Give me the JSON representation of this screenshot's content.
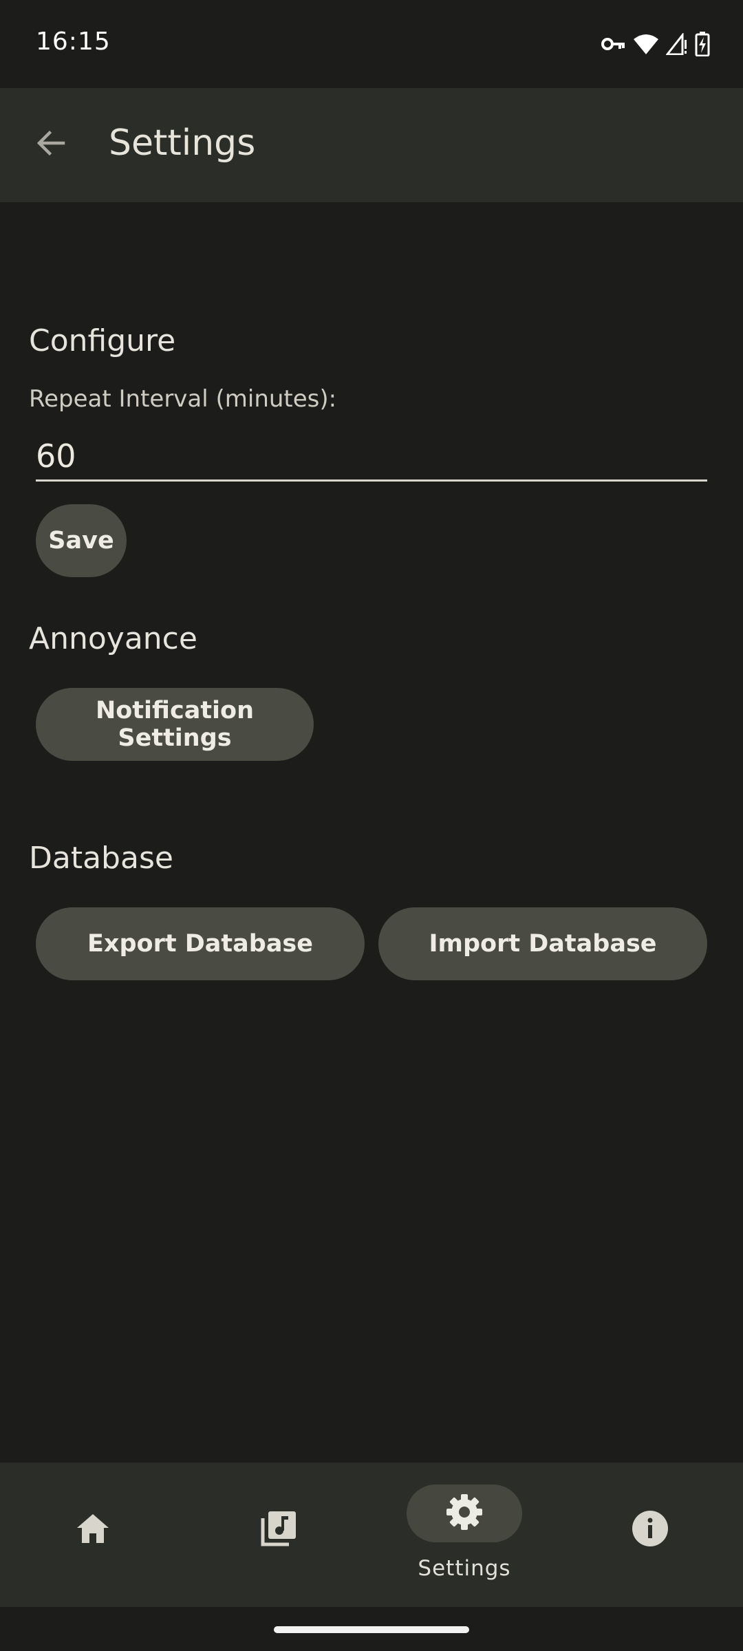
{
  "status_bar": {
    "time": "16:15",
    "icons": [
      "vpn-key-icon",
      "wifi-icon",
      "signal-icon",
      "battery-charging-icon"
    ]
  },
  "app_bar": {
    "title": "Settings",
    "back_icon": "arrow-back-icon"
  },
  "configure": {
    "title": "Configure",
    "field_label": "Repeat Interval (minutes):",
    "field_value": "60",
    "save_label": "Save"
  },
  "annoyance": {
    "title": "Annoyance",
    "notification_button": "Notification Settings"
  },
  "database": {
    "title": "Database",
    "export_button": "Export Database",
    "import_button": "Import Database"
  },
  "bottom_nav": {
    "items": [
      {
        "icon": "home-icon",
        "label": "",
        "active": false
      },
      {
        "icon": "music-library-icon",
        "label": "",
        "active": false
      },
      {
        "icon": "gear-icon",
        "label": "Settings",
        "active": true
      },
      {
        "icon": "info-icon",
        "label": "",
        "active": false
      }
    ]
  },
  "colors": {
    "background": "#1c1c1a",
    "app_bar": "#2b2d28",
    "button": "#4a4b42",
    "active_nav": "#46473f",
    "text": "#e6e4dc"
  }
}
